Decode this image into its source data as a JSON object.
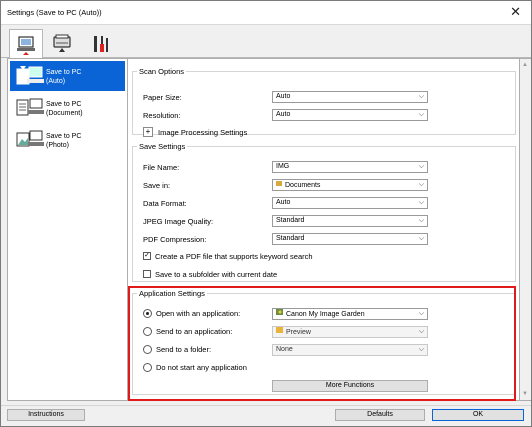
{
  "window": {
    "title": "Settings (Save to PC (Auto))"
  },
  "toolbar": {
    "tabs": [
      {
        "icon": "computer-scan-icon"
      },
      {
        "icon": "scanner-icon"
      },
      {
        "icon": "tools-icon"
      }
    ]
  },
  "modes": [
    {
      "label": "Save to PC\n(Auto)",
      "selected": true
    },
    {
      "label": "Save to PC\n(Document)",
      "selected": false
    },
    {
      "label": "Save to PC\n(Photo)",
      "selected": false
    }
  ],
  "scan_options": {
    "legend": "Scan Options",
    "paper_size": {
      "label": "Paper Size:",
      "value": "Auto"
    },
    "resolution": {
      "label": "Resolution:",
      "value": "Auto"
    },
    "image_processing": {
      "label": "Image Processing Settings",
      "toggle": "+"
    }
  },
  "save_settings": {
    "legend": "Save Settings",
    "file_name": {
      "label": "File Name:",
      "value": "IMG"
    },
    "save_in": {
      "label": "Save in:",
      "value": "Documents"
    },
    "data_format": {
      "label": "Data Format:",
      "value": "Auto"
    },
    "jpeg_quality": {
      "label": "JPEG Image Quality:",
      "value": "Standard"
    },
    "pdf_compression": {
      "label": "PDF Compression:",
      "value": "Standard"
    },
    "create_pdf": {
      "label": "Create a PDF file that supports keyword search",
      "checked": true,
      "mark": "✓"
    },
    "subfolder": {
      "label": "Save to a subfolder with current date",
      "checked": false
    }
  },
  "application_settings": {
    "legend": "Application Settings",
    "open_with": {
      "label": "Open with an application:",
      "value": "Canon My Image Garden",
      "selected": true
    },
    "send_to_app": {
      "label": "Send to an application:",
      "value": "Preview",
      "selected": false
    },
    "send_to_folder": {
      "label": "Send to a folder:",
      "value": "None",
      "selected": false
    },
    "do_not_start": {
      "label": "Do not start any application",
      "selected": false
    },
    "more_functions": "More Functions"
  },
  "footer": {
    "instructions": "Instructions",
    "defaults": "Defaults",
    "ok": "OK"
  },
  "colors": {
    "selection": "#0a64d6",
    "highlight": "#e0191b"
  }
}
